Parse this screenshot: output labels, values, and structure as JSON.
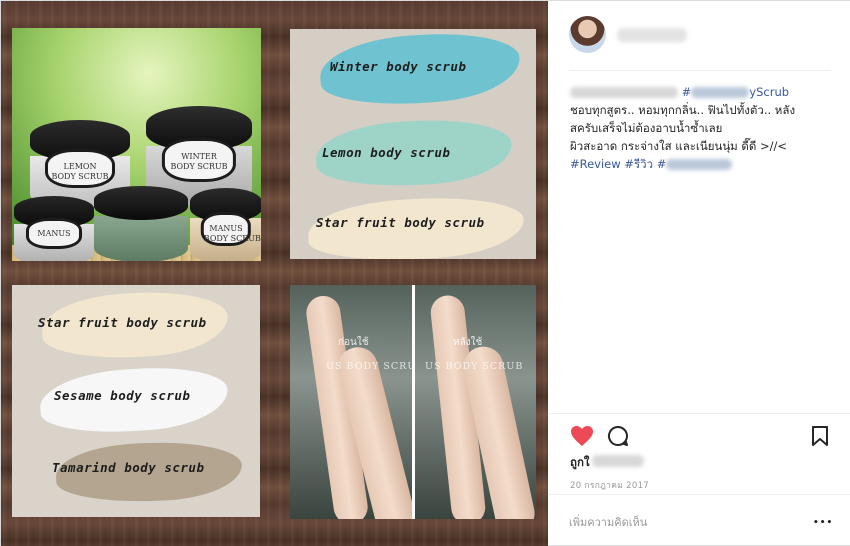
{
  "post": {
    "username": "",
    "caption": {
      "line1_prefix": "",
      "line1_hashtag_start": "#",
      "line1_hashtag_end": "yScrub",
      "line2": "ชอบทุกสูตร.. หอมทุกกลิ่น.. ฟินไปทั้งตัว.. หลัง",
      "line3": "สครับเสร็จไม่ต้องอาบน้ำซ้ำเลย",
      "line4": "ผิวสะอาด กระจ่างใส และเนียนนุ่ม ดี๊ดี >//<",
      "tag_review": "#Review",
      "tag_rewiew_th": "#รีวิว",
      "tag_last_start": "#"
    },
    "likes_prefix": "ถูกใ",
    "date": "20 กรกฎาคม 2017",
    "comment_placeholder": "เพิ่มความคิดเห็น",
    "more_label": "•••"
  },
  "images": {
    "jars": {
      "jar_front_label": "WINTER\nBODY SCRUB",
      "jar_left_brand": "MANUS",
      "jar_left_label": "LEMON\nBODY SCRUB",
      "jar_small_label": "MANUS",
      "jar_right_label": "MANUS\nBODY SCRUB"
    },
    "scrubs_top": [
      "Winter body scrub",
      "Lemon body scrub",
      "Star fruit body scrub"
    ],
    "scrubs_bottom": [
      "Star fruit body scrub",
      "Sesame body scrub",
      "Tamarind body scrub"
    ],
    "legs": {
      "before": "ก่อนใช้",
      "after": "หลังใช้",
      "watermark_left": "US BODY SCRUB",
      "watermark_right": "US BODY SCRUB"
    }
  },
  "colors": {
    "heart": "#ed4956",
    "hashtag": "#385898",
    "winter_smear": "#6fc2cf",
    "lemon_smear": "#9ed3c8",
    "starfruit_smear": "#f2e6cf",
    "sesame_smear": "#f7f7f7",
    "tamarind_smear": "#b3a58f"
  },
  "icons": {
    "like": "heart-icon",
    "comment": "comment-icon",
    "save": "bookmark-icon",
    "more": "more-dots-icon"
  }
}
